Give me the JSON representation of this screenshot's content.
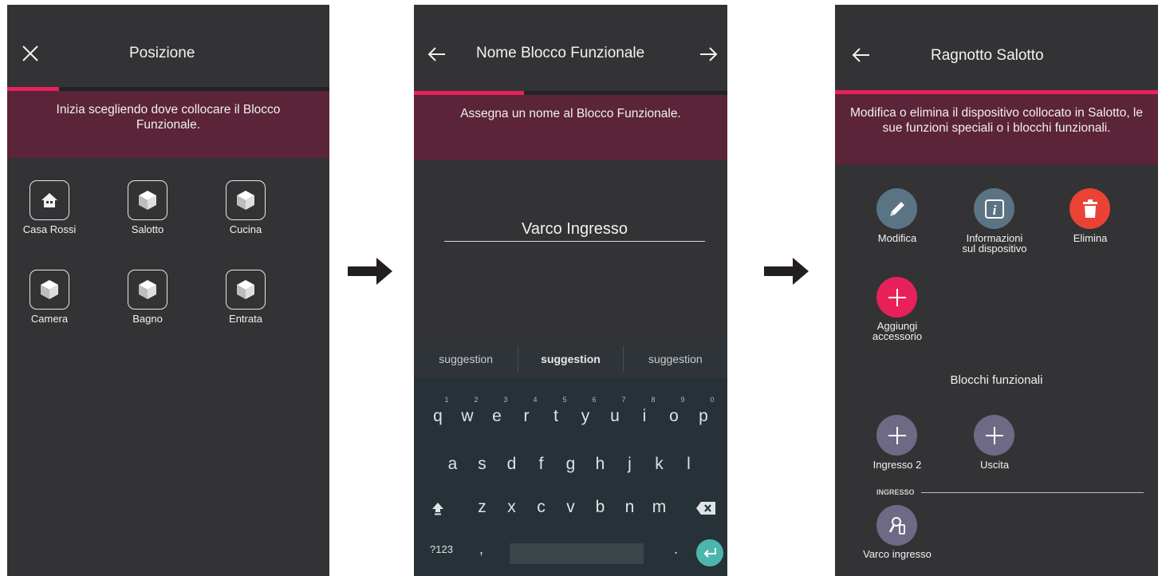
{
  "screen1": {
    "title": "Posizione",
    "banner": "Inizia scegliendo dove collocare il Blocco Funzionale.",
    "progress": 0.16,
    "locations": [
      {
        "label": "Casa Rossi",
        "icon": "home-icon"
      },
      {
        "label": "Salotto",
        "icon": "cube-icon"
      },
      {
        "label": "Cucina",
        "icon": "cube-icon"
      },
      {
        "label": "Camera",
        "icon": "cube-icon"
      },
      {
        "label": "Bagno",
        "icon": "cube-icon"
      },
      {
        "label": "Entrata",
        "icon": "cube-icon"
      }
    ]
  },
  "screen2": {
    "title": "Nome Blocco Funzionale",
    "banner": "Assegna un nome al Blocco Funzionale.",
    "progress": 0.35,
    "name_value": "Varco Ingresso",
    "keyboard": {
      "suggestions": [
        "suggestion",
        "suggestion",
        "suggestion"
      ],
      "row1": [
        {
          "k": "q",
          "n": "1"
        },
        {
          "k": "w",
          "n": "2"
        },
        {
          "k": "e",
          "n": "3"
        },
        {
          "k": "r",
          "n": "4"
        },
        {
          "k": "t",
          "n": "5"
        },
        {
          "k": "y",
          "n": "6"
        },
        {
          "k": "u",
          "n": "7"
        },
        {
          "k": "i",
          "n": "8"
        },
        {
          "k": "o",
          "n": "9"
        },
        {
          "k": "p",
          "n": "0"
        }
      ],
      "row2": [
        "a",
        "s",
        "d",
        "f",
        "g",
        "h",
        "j",
        "k",
        "l"
      ],
      "row3": [
        "z",
        "x",
        "c",
        "v",
        "b",
        "n",
        "m"
      ],
      "symbols_key": "?123",
      "comma_key": ",",
      "period_key": "."
    }
  },
  "screen3": {
    "title": "Ragnotto Salotto",
    "banner": "Modifica o elimina il dispositivo collocato in Salotto, le sue funzioni speciali o i blocchi funzionali.",
    "actions": {
      "modify": "Modifica",
      "info_line1": "Informazioni",
      "info_line2": "sul dispositivo",
      "delete": "Elimina",
      "add_line1": "Aggiungi",
      "add_line2": "accessorio"
    },
    "blocks_title": "Blocchi funzionali",
    "blocks": [
      "Ingresso 2",
      "Uscita"
    ],
    "section_label": "INGRESSO",
    "existing_block": "Varco ingresso"
  },
  "colors": {
    "screen_bg": "#333335",
    "banner_bg": "#5c2438",
    "accent": "#e8215b",
    "delete_red": "#ea4335",
    "action_gray": "#5b7483",
    "block_purple": "#6d6a86",
    "keyboard_bg": "#263238",
    "enter_teal": "#4db6ac"
  }
}
